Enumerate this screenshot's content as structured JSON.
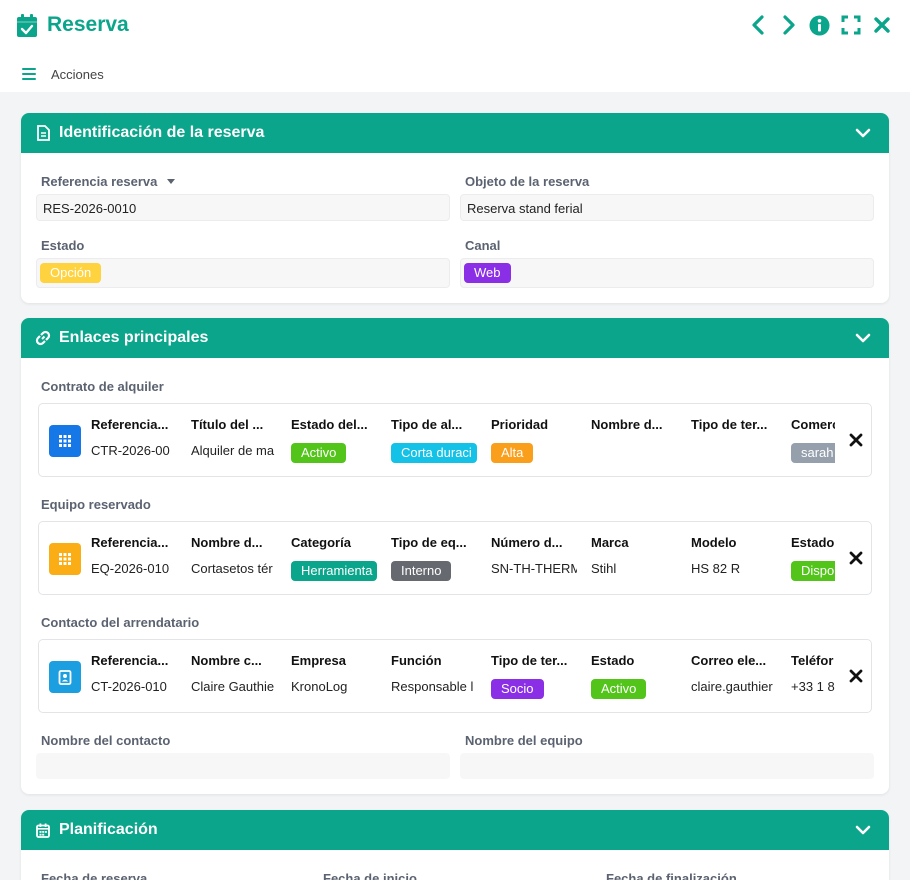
{
  "header": {
    "title": "Reserva",
    "icons": [
      "calendar-check-icon",
      "chevron-left-icon",
      "chevron-right-icon",
      "info-icon",
      "fullscreen-icon",
      "close-icon"
    ]
  },
  "actions": {
    "label": "Acciones"
  },
  "identificacion": {
    "title": "Identificación de la reserva",
    "referencia_label": "Referencia reserva",
    "referencia_value": "RES-2026-0010",
    "objeto_label": "Objeto de la reserva",
    "objeto_value": "Reserva stand ferial",
    "estado_label": "Estado",
    "estado_value": "Opción",
    "canal_label": "Canal",
    "canal_value": "Web"
  },
  "enlaces": {
    "title": "Enlaces principales",
    "contrato": {
      "label": "Contrato de alquiler",
      "headers": [
        "Referencia...",
        "Título del ...",
        "Estado del...",
        "Tipo de al...",
        "Prioridad",
        "Nombre d...",
        "Tipo de ter...",
        "Comerc"
      ],
      "values": [
        "CTR-2026-00",
        "Alquiler de ma",
        "Activo",
        "Corta duraci",
        "Alta",
        "",
        "",
        "sarah"
      ]
    },
    "equipo": {
      "label": "Equipo reservado",
      "headers": [
        "Referencia...",
        "Nombre d...",
        "Categoría",
        "Tipo de eq...",
        "Número d...",
        "Marca",
        "Modelo",
        "Estado"
      ],
      "values": [
        "EQ-2026-010",
        "Cortasetos tér",
        "Herramienta",
        "Interno",
        "SN-TH-THERM",
        "Stihl",
        "HS 82 R",
        "Dispo"
      ]
    },
    "contacto": {
      "label": "Contacto del arrendatario",
      "headers": [
        "Referencia...",
        "Nombre c...",
        "Empresa",
        "Función",
        "Tipo de ter...",
        "Estado",
        "Correo ele...",
        "Teléfor"
      ],
      "values": [
        "CT-2026-010",
        "Claire Gauthie",
        "KronoLog",
        "Responsable l",
        "Socio",
        "Activo",
        "claire.gauthier",
        "+33 1 8"
      ]
    },
    "nombre_contacto_label": "Nombre del contacto",
    "nombre_contacto_value": "",
    "nombre_equipo_label": "Nombre del equipo",
    "nombre_equipo_value": ""
  },
  "planificacion": {
    "title": "Planificación",
    "fecha_reserva_label": "Fecha de reserva",
    "fecha_inicio_label": "Fecha de inicio",
    "fecha_fin_label": "Fecha de finalización"
  },
  "colors": {
    "accent": "#0aa58b",
    "opcion": "#ffd23f",
    "web": "#8b2fe6",
    "activo": "#52c41a",
    "corta": "#13c2e6",
    "alta": "#fa9f1c",
    "comercial": "#96a0ad",
    "herramienta": "#0aa58b",
    "interno": "#666a70",
    "socio": "#8b2fe6",
    "contrato_icon": "#1677e6",
    "equipo_icon": "#faad14",
    "contacto_icon": "#1c9fe0"
  }
}
